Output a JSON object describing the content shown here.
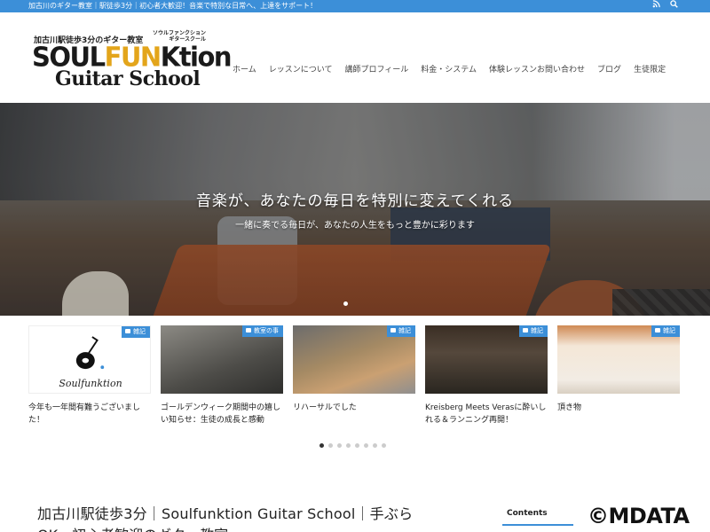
{
  "topbar": {
    "text": "加古川のギター教室｜駅徒歩3分｜初心者大歓迎！音楽で特別な日常へ、上達をサポート！",
    "icons": [
      "rss-icon",
      "search-icon"
    ]
  },
  "logo": {
    "line1": "加古川駅徒歩3分のギター教室",
    "line1_kana_a": "ソウルファンクション",
    "line1_kana_b": "ギタースクール",
    "brand_a": "SOUL",
    "brand_b": "FUN",
    "brand_c": "Ktion",
    "line3": "Guitar School",
    "accent": "#e3a51b"
  },
  "nav": {
    "items": [
      {
        "label": "ホーム"
      },
      {
        "label": "レッスンについて"
      },
      {
        "label": "講師プロフィール"
      },
      {
        "label": "料金・システム"
      },
      {
        "label": "体験レッスンお問い合わせ"
      },
      {
        "label": "ブログ"
      },
      {
        "label": "生徒限定"
      }
    ]
  },
  "hero": {
    "headline": "音楽が、あなたの毎日を特別に変えてくれる",
    "subline": "一緒に奏でる毎日が、あなたの人生をもっと豊かに彩ります"
  },
  "cards": [
    {
      "badge": "雑記",
      "title": "今年も一年間有難うございました！",
      "thumb_text": "Soulfunktion"
    },
    {
      "badge": "教室の事",
      "title": "ゴールデンウィーク期間中の嬉しい知らせ：生徒の成長と感動"
    },
    {
      "badge": "雑記",
      "title": "リハーサルでした"
    },
    {
      "badge": "雑記",
      "title": "Kreisberg Meets Verasに酔いしれる＆ランニング再開！"
    },
    {
      "badge": "雑記",
      "title": "頂き物"
    }
  ],
  "carousel": {
    "count": 8,
    "active": 0
  },
  "article": {
    "title_line1": "加古川駅徒歩3分｜Soulfunktion Guitar School｜手ぶら",
    "title_line2": "OK・初心者歓迎のギター教室"
  },
  "toc": {
    "label": "Contents"
  },
  "watermark": "©MDATA",
  "colors": {
    "primary": "#3c8fd8"
  }
}
